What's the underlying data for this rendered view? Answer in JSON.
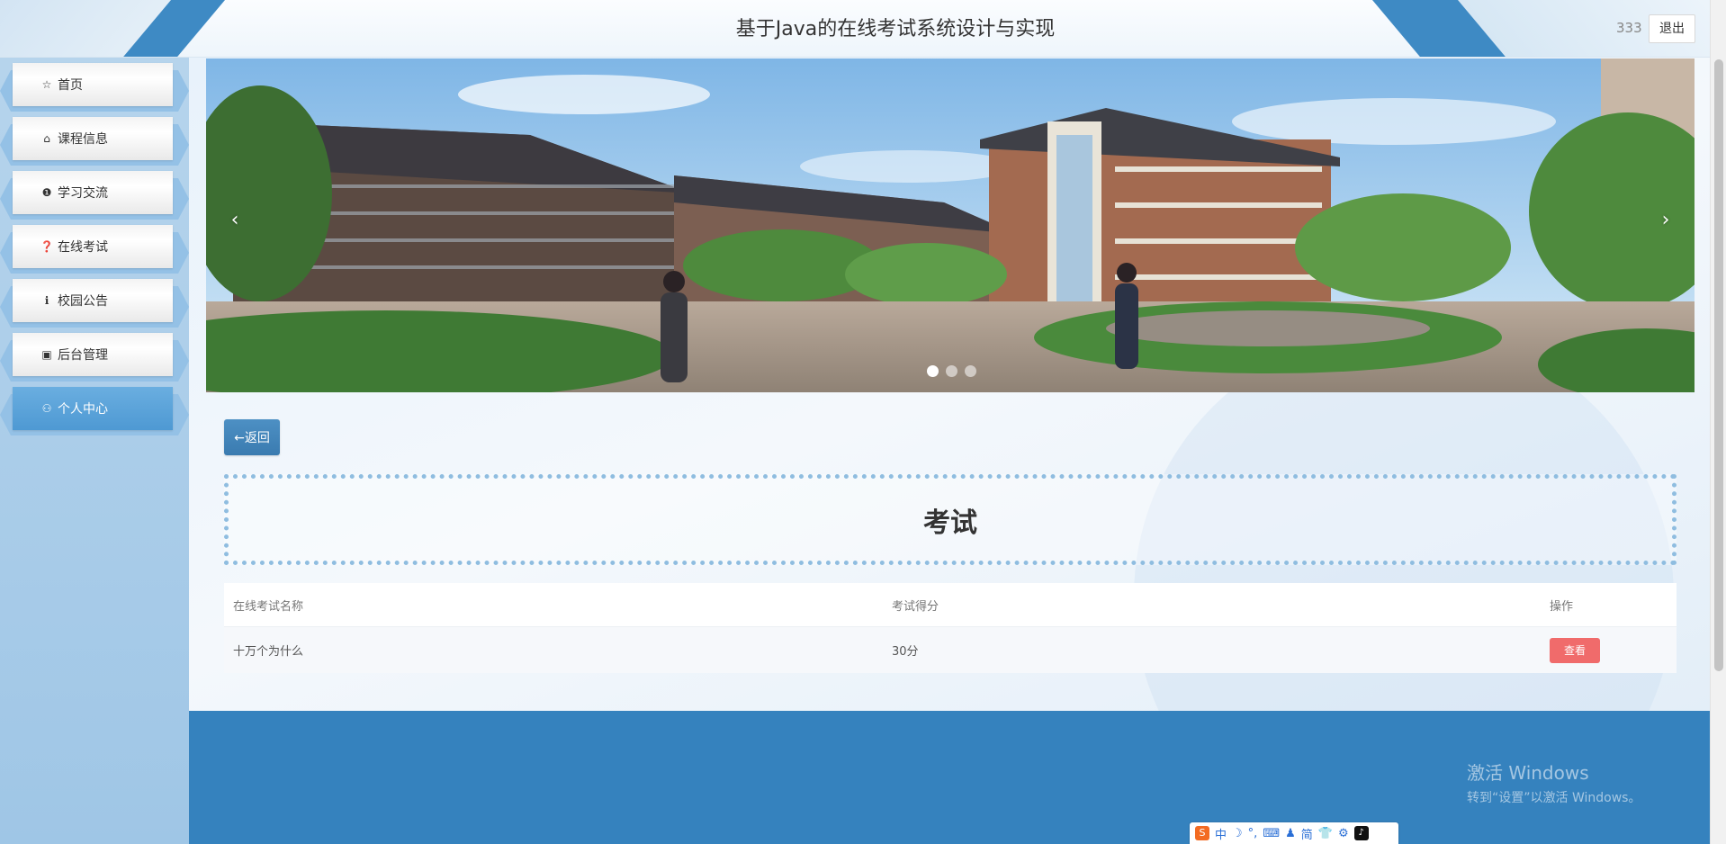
{
  "header": {
    "title": "基于Java的在线考试系统设计与实现",
    "user_name": "333",
    "logout_label": "退出"
  },
  "sidebar": {
    "items": [
      {
        "label": "首页",
        "icon": "star-icon",
        "glyph": "☆"
      },
      {
        "label": "课程信息",
        "icon": "bag-icon",
        "glyph": "⌂"
      },
      {
        "label": "学习交流",
        "icon": "alert-circle-icon",
        "glyph": "❶"
      },
      {
        "label": "在线考试",
        "icon": "help-circle-icon",
        "glyph": "❓"
      },
      {
        "label": "校园公告",
        "icon": "info-circle-icon",
        "glyph": "ℹ"
      },
      {
        "label": "后台管理",
        "icon": "briefcase-icon",
        "glyph": "▣"
      },
      {
        "label": "个人中心",
        "icon": "user-icon",
        "glyph": "⚇",
        "active": true
      }
    ]
  },
  "banner": {
    "prev_glyph": "‹",
    "next_glyph": "›",
    "slide_count": 3,
    "active_slide": 0
  },
  "back_label": "←返回",
  "section_title": "考试",
  "table": {
    "headers": [
      "在线考试名称",
      "考试得分",
      "操作"
    ],
    "rows": [
      {
        "name": "十万个为什么",
        "score": "30分",
        "action": "查看"
      }
    ]
  },
  "windows_notice": {
    "line1": "激活 Windows",
    "line2": "转到“设置”以激活 Windows。"
  },
  "ime": {
    "items": [
      "中",
      "☽",
      "°,",
      "⌨",
      "♟",
      "简",
      "👕",
      "⚙"
    ]
  },
  "colors": {
    "header_accent": "#3e8ac4",
    "active_nav": "#4e99d3",
    "footer": "#3582be",
    "view_button": "#f06b6b"
  }
}
